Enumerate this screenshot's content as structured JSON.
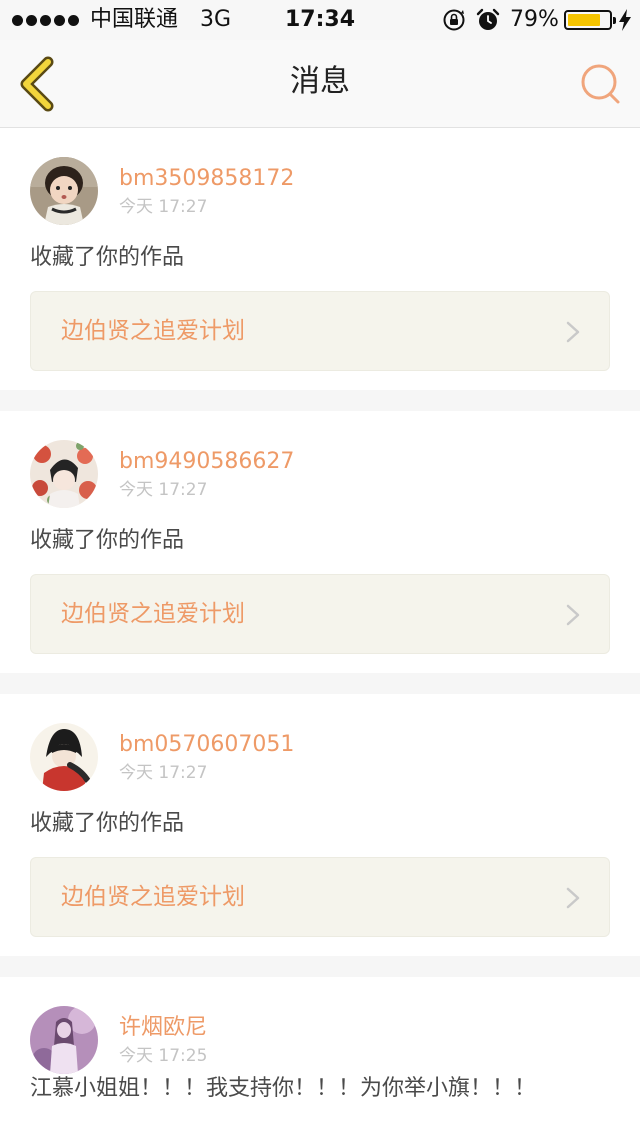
{
  "status_bar": {
    "carrier": "中国联通",
    "network": "3G",
    "time": "17:34",
    "battery_percent": "79%",
    "battery_level": 0.79
  },
  "nav": {
    "title": "消息",
    "back_icon": "chevron-left-icon",
    "search_icon": "search-icon"
  },
  "colors": {
    "accent": "#ee9a67",
    "back_arrow": "#f2d53c",
    "card_bg": "#ffffff",
    "link_bg": "#f5f4ec"
  },
  "messages": [
    {
      "username": "bm3509858172",
      "time": "今天 17:27",
      "action": "收藏了你的作品",
      "work_title": "边伯贤之追爱计划"
    },
    {
      "username": "bm9490586627",
      "time": "今天 17:27",
      "action": "收藏了你的作品",
      "work_title": "边伯贤之追爱计划"
    },
    {
      "username": "bm0570607051",
      "time": "今天 17:27",
      "action": "收藏了你的作品",
      "work_title": "边伯贤之追爱计划"
    },
    {
      "username": "许烟欧尼",
      "time": "今天 17:25",
      "action": "江慕小姐姐！！！我支持你！！！为你举小旗！！！"
    }
  ]
}
